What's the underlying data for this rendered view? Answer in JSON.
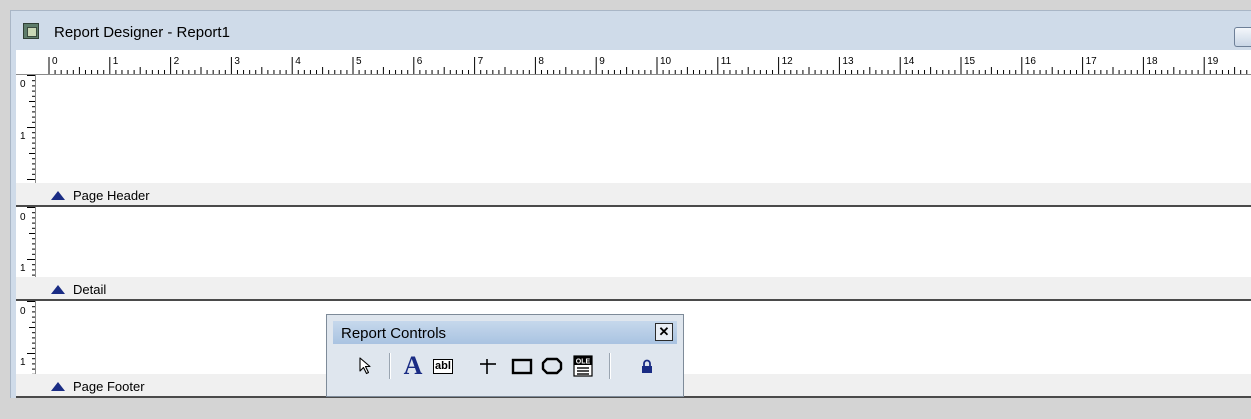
{
  "window": {
    "title": "Report Designer - Report1"
  },
  "ruler": {
    "horizontal_labels": [
      "0",
      "1",
      "2",
      "3",
      "4",
      "5",
      "6",
      "7",
      "8",
      "9",
      "10",
      "11",
      "12",
      "13",
      "14",
      "15",
      "16",
      "17",
      "18",
      "19"
    ]
  },
  "bands": [
    {
      "name": "Page Header",
      "vruler_labels": [
        "0",
        "1"
      ]
    },
    {
      "name": "Detail",
      "vruler_labels": [
        "0",
        "1"
      ]
    },
    {
      "name": "Page Footer",
      "vruler_labels": [
        "0",
        "1"
      ]
    }
  ],
  "toolbar": {
    "title": "Report Controls",
    "close_glyph": "✕",
    "tools": [
      {
        "icon": "pointer-icon"
      },
      {
        "icon": "label-icon",
        "glyph": "A"
      },
      {
        "icon": "field-icon",
        "glyph": "abl"
      },
      {
        "icon": "line-icon"
      },
      {
        "icon": "rectangle-icon"
      },
      {
        "icon": "rounded-rectangle-icon"
      },
      {
        "icon": "ole-picture-icon",
        "glyph": "OLE"
      },
      {
        "icon": "lock-icon"
      }
    ]
  }
}
